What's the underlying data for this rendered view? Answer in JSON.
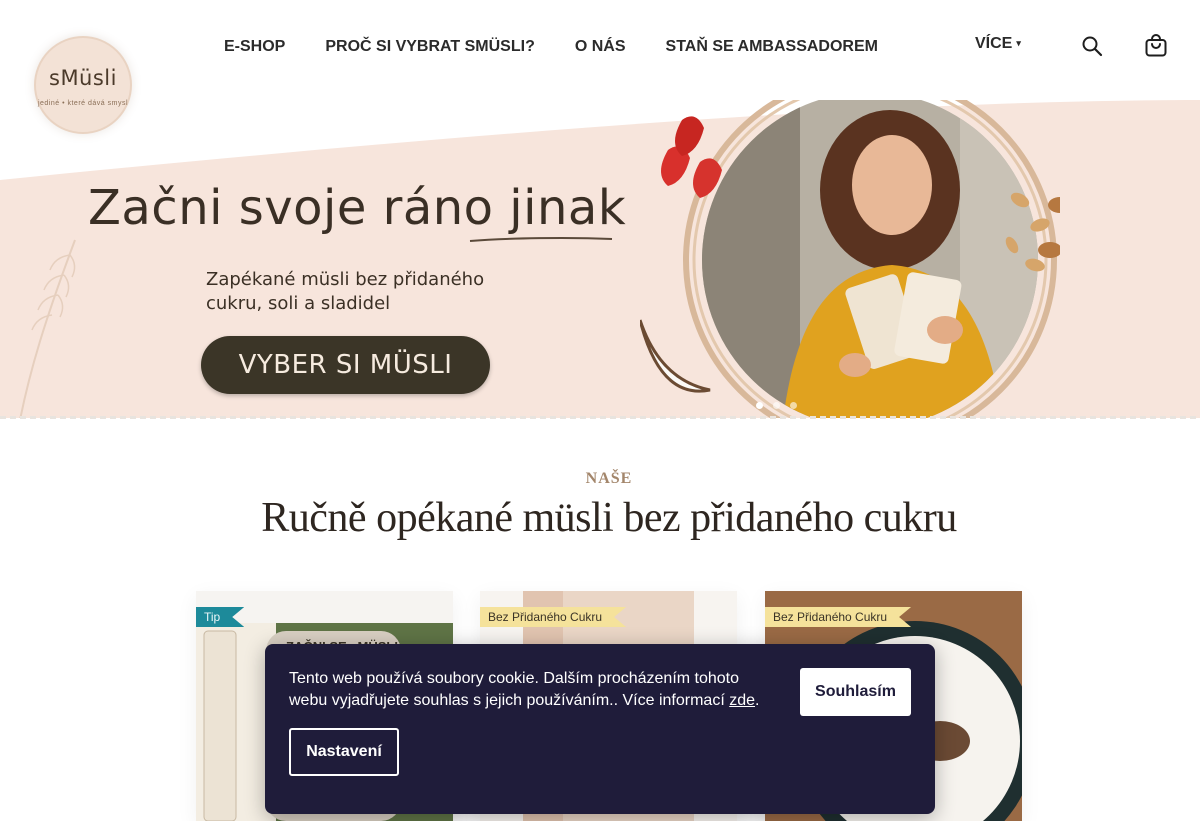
{
  "header": {
    "logo_text": "sMüsli",
    "logo_tagline": "jediné • které dává smysl",
    "nav": [
      {
        "label": "E-SHOP"
      },
      {
        "label": "PROČ SI VYBRAT SMÜSLI?"
      },
      {
        "label": "O NÁS"
      },
      {
        "label": "STAŇ SE AMBASSADOREM"
      }
    ],
    "more_label": "VÍCE",
    "icons": {
      "search": "search-icon",
      "cart": "cart-icon",
      "more": "chevron-down-icon"
    }
  },
  "hero": {
    "headline": "Začni svoje ráno jinak",
    "subline": "Zapékané müsli bez přidaného cukru, soli a sladidel",
    "cta": "VYBER SI MÜSLI",
    "slides": 3,
    "active_slide": 1
  },
  "section": {
    "eyebrow": "NAŠE",
    "title": "Ručně opékané müsli bez přidaného cukru"
  },
  "products": [
    {
      "badge": "Tip"
    },
    {
      "badge": "Bez Přidaného Cukru"
    },
    {
      "badge": "Bez Přidaného Cukru"
    }
  ],
  "cookie": {
    "text": "Tento web používá soubory cookie. Dalším procházením tohoto webu vyjadřujete souhlas s jejich používáním.. Více informací ",
    "link": "zde",
    "after_link": ".",
    "accept": "Souhlasím",
    "settings": "Nastavení"
  },
  "colors": {
    "hero_bg": "#f7e5dc",
    "cta_bg": "#3b3527",
    "cookie_bg": "#1f1c3a",
    "badge_tip": "#1d8a9a",
    "badge_sugar": "#f5e29b",
    "eyebrow": "#a3866b"
  }
}
